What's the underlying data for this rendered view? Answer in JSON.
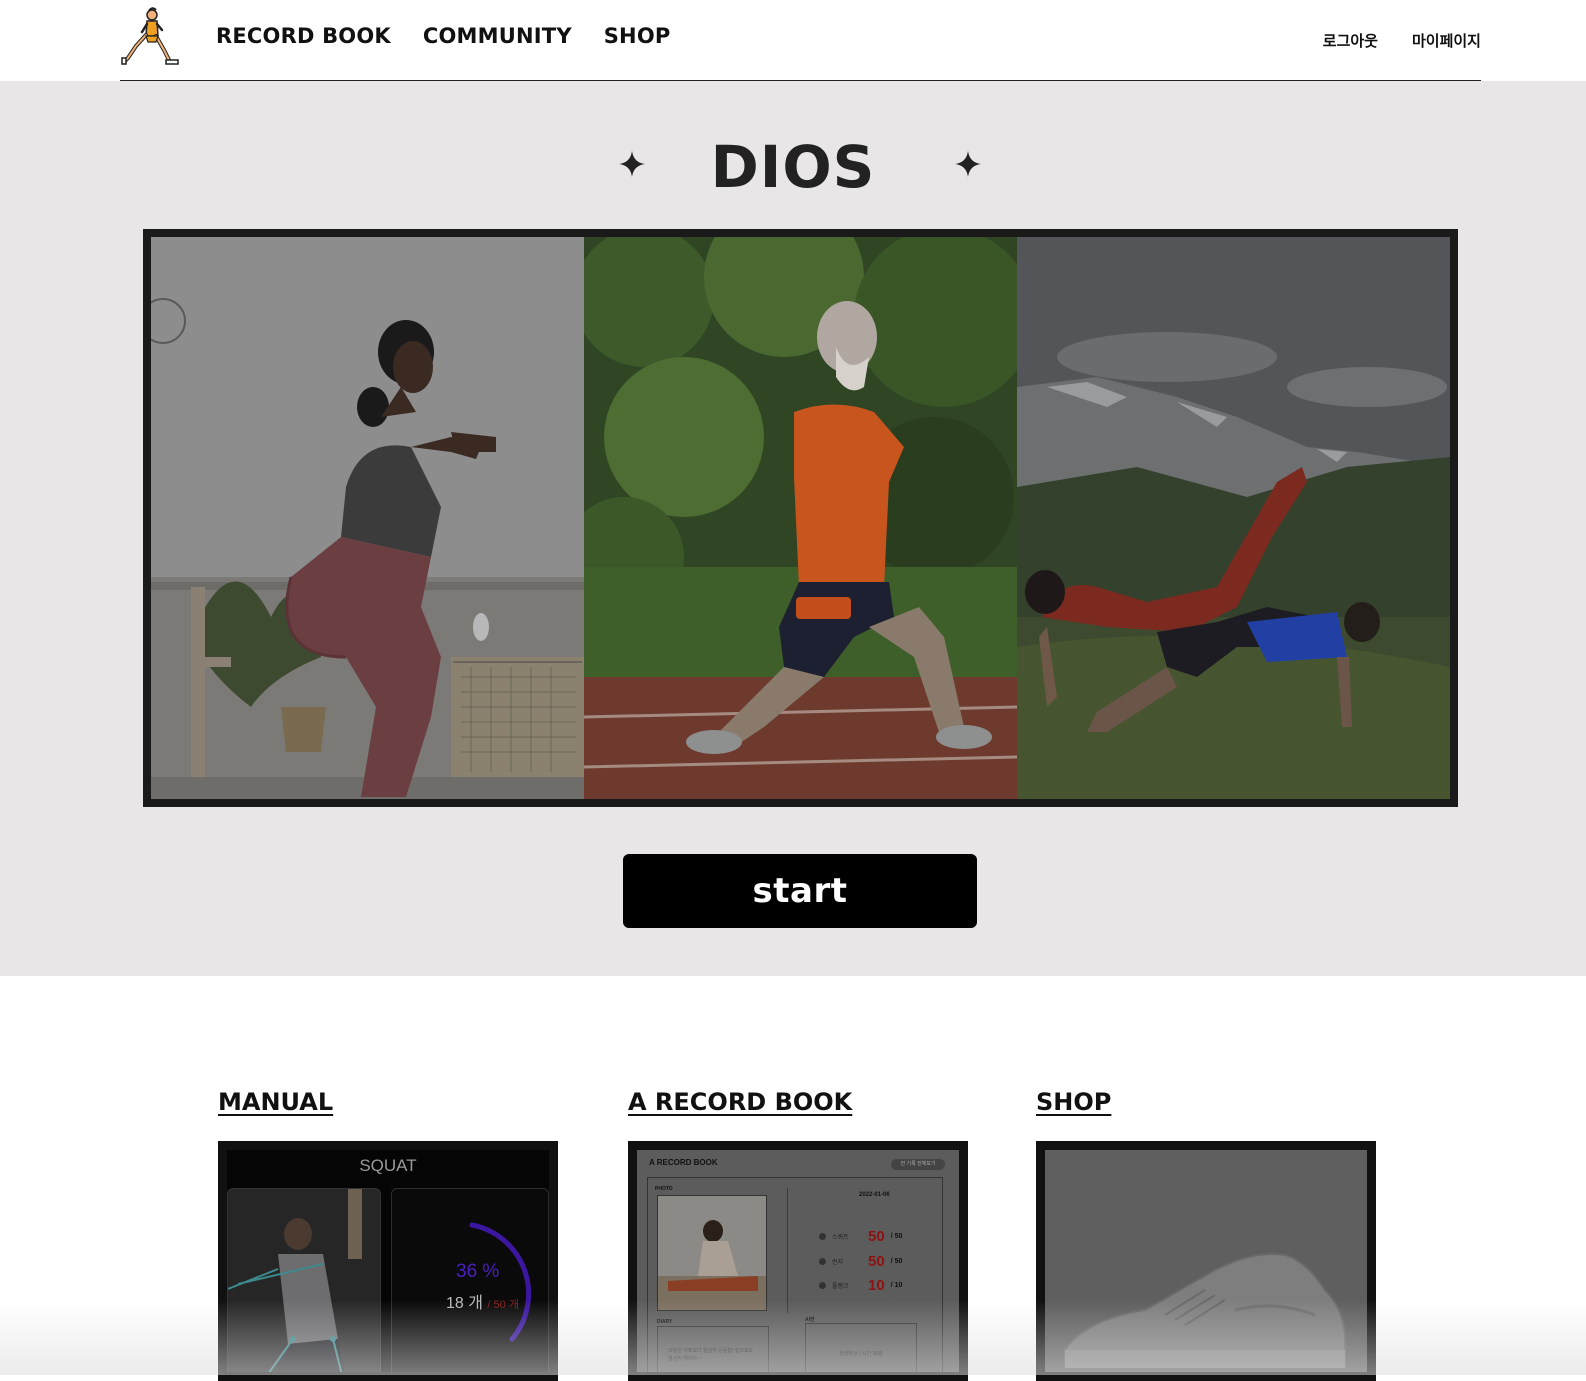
{
  "nav": {
    "links": [
      "RECORD BOOK",
      "COMMUNITY",
      "SHOP"
    ],
    "logout": "로그아웃",
    "mypage": "마이페이지"
  },
  "hero": {
    "title": "DIOS",
    "start_label": "start",
    "photos": [
      "squat-woman",
      "lunge-man",
      "outdoor-stretch-pair"
    ]
  },
  "sections": [
    {
      "title": "MANUAL"
    },
    {
      "title": "A RECORD BOOK"
    },
    {
      "title": "SHOP"
    }
  ],
  "manual_card": {
    "exercise": "SQUAT",
    "percent": "36 %",
    "count": "18 개",
    "goal": "/ 50 개"
  },
  "record_card": {
    "title": "A RECORD BOOK",
    "tag": "전 기록 전체보기",
    "photo_label": "PHOTO",
    "date": "2022-01-06",
    "stats": [
      {
        "label": "스쿼트",
        "value": "50",
        "total": "/ 50"
      },
      {
        "label": "런지",
        "value": "50",
        "total": "/ 50"
      },
      {
        "label": "플랭크",
        "value": "10",
        "total": "/ 10"
      }
    ],
    "diary_label": "DIARY",
    "diary_text": "오늘은 어제보다 열심히 운동함! 앞으로도 열심히 해야지~~",
    "ai_label": "AI안",
    "ai_text": "완성하신 ( 시간 30분"
  },
  "colors": {
    "hero_bg": "#e8e6e7",
    "button_bg": "#000000",
    "accent_red": "#8e1212",
    "accent_purple": "#4b1fc1"
  }
}
